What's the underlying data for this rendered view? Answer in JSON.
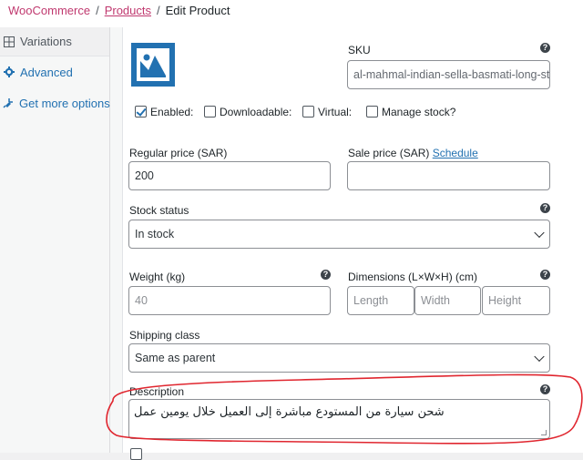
{
  "breadcrumb": {
    "woocommerce": "WooCommerce",
    "products": "Products",
    "current": "Edit Product",
    "separator": "/"
  },
  "sidebar": {
    "items": [
      {
        "label": "Variations",
        "icon": "grid-icon"
      },
      {
        "label": "Advanced",
        "icon": "gear-icon"
      },
      {
        "label": "Get more options",
        "icon": "plugin-icon"
      }
    ]
  },
  "variation": {
    "sku_label": "SKU",
    "sku_value": "al-mahmal-indian-sella-basmati-long-stra",
    "checkboxes": [
      {
        "label": "Enabled:",
        "checked": true
      },
      {
        "label": "Downloadable:",
        "checked": false
      },
      {
        "label": "Virtual:",
        "checked": false
      },
      {
        "label": "Manage stock?",
        "checked": false
      }
    ],
    "regular_price_label": "Regular price (SAR)",
    "regular_price_value": "200",
    "sale_price_label": "Sale price (SAR)",
    "schedule_link": "Schedule",
    "sale_price_value": "",
    "stock_status_label": "Stock status",
    "stock_status_value": "In stock",
    "weight_label": "Weight (kg)",
    "weight_placeholder": "40",
    "dimensions_label": "Dimensions (L×W×H) (cm)",
    "length_placeholder": "Length",
    "width_placeholder": "Width",
    "height_placeholder": "Height",
    "shipping_class_label": "Shipping class",
    "shipping_class_value": "Same as parent",
    "description_label": "Description",
    "description_value": "شحن سيارة من المستودع مباشرة إلى العميل خلال يومين عمل"
  },
  "colors": {
    "link": "#2271b1",
    "breadcrumb_link": "#c0396f",
    "annotation": "#e0262f",
    "thumbnail": "#2271b1"
  },
  "help_icon_text": "?"
}
